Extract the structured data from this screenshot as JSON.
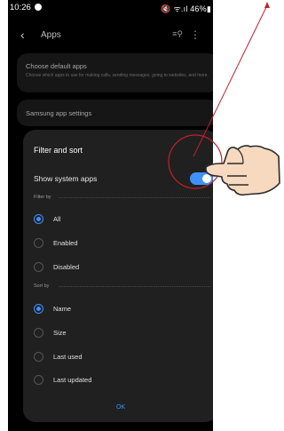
{
  "status_bar": {
    "time": "10:26",
    "icons": "🔇 ᯤ.ıl 46%▮"
  },
  "header": {
    "title": "Apps"
  },
  "background_cards": {
    "default_apps_title": "Choose default apps",
    "default_apps_subtitle": "Choose which apps to use for making calls, sending messages, going to websites, and more.",
    "samsung_settings_title": "Samsung app settings"
  },
  "sheet": {
    "title": "Filter and sort",
    "toggle": {
      "label": "Show system apps",
      "on": true
    },
    "filter_by": {
      "label": "Filter by",
      "options": [
        "All",
        "Enabled",
        "Disabled"
      ],
      "selected": "All"
    },
    "sort_by": {
      "label": "Sort by",
      "options": [
        "Name",
        "Size",
        "Last used",
        "Last updated"
      ],
      "selected": "Name"
    },
    "ok_label": "OK"
  },
  "colors": {
    "accent": "#3e91ff",
    "sheet_bg": "#202020",
    "annotation": "#c0202a"
  },
  "icons": [
    "back-icon",
    "filter-search-icon",
    "more-vert-icon",
    "pointing-hand-icon"
  ]
}
